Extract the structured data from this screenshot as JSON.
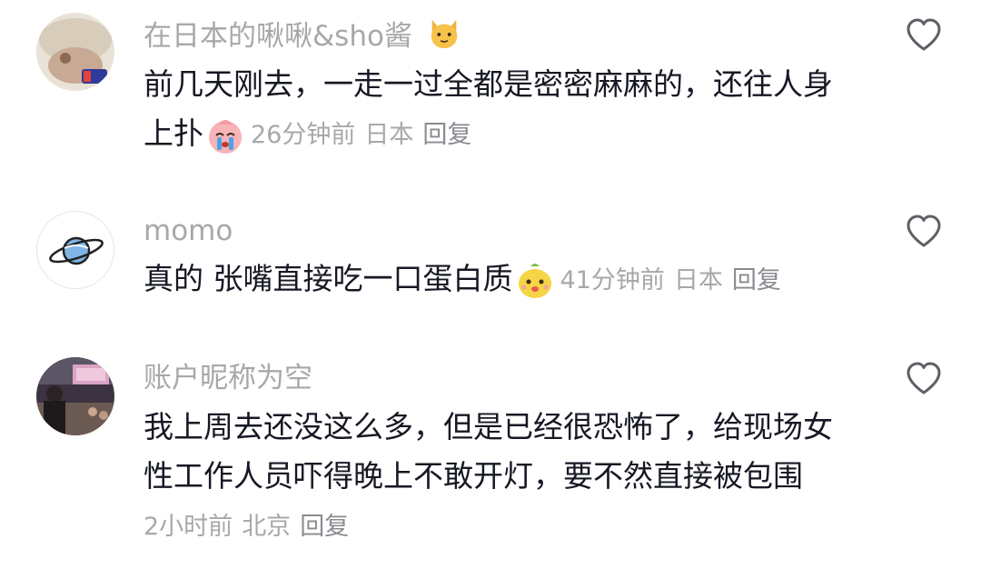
{
  "comments": [
    {
      "username": "在日本的啾啾&sho酱",
      "username_emoji": "cat-face-emoji",
      "text_line1": "前几天刚去，一走一过全都是密密麻麻的，还往人身",
      "text_line2": "上扑",
      "text_emoji": "crying-face-emoji",
      "time": "26分钟前",
      "location": "日本",
      "reply": "回复"
    },
    {
      "username": "momo",
      "text_line1": "真的 张嘴直接吃一口蛋白质",
      "text_emoji": "yellow-creature-emoji",
      "time": "41分钟前",
      "location": "日本",
      "reply": "回复"
    },
    {
      "username": "账户昵称为空",
      "text_line1": "我上周去还没这么多，但是已经很恐怖了，给现场女",
      "text_line2": "性工作人员吓得晚上不敢开灯，要不然直接被包围",
      "time": "2小时前",
      "location": "北京",
      "reply": "回复"
    }
  ],
  "colors": {
    "text": "#161823",
    "muted": "#a7a8ab",
    "heart_stroke": "#5f6066"
  }
}
